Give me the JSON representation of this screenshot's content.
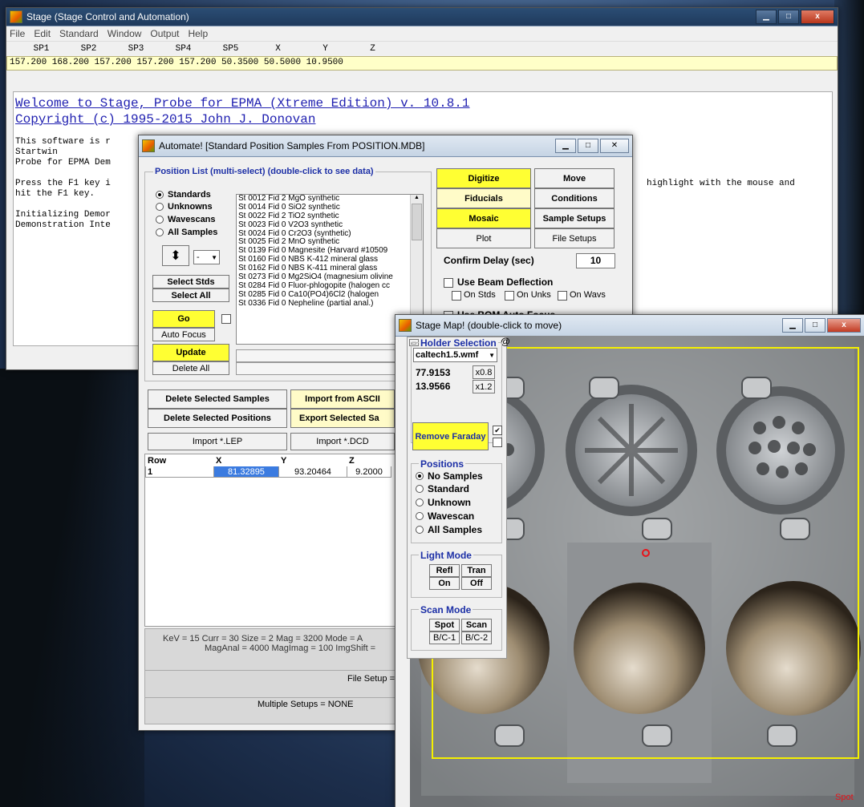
{
  "main_window": {
    "title": "Stage (Stage Control and Automation)",
    "menu": [
      "File",
      "Edit",
      "Standard",
      "Window",
      "Output",
      "Help"
    ],
    "position_headers": [
      "SP1",
      "SP2",
      "SP3",
      "SP4",
      "SP5",
      "X",
      "Y",
      "Z"
    ],
    "position_values": "157.200 168.200 157.200 157.200 157.200 50.3500 50.5000 10.9500",
    "log": {
      "welcome": "Welcome to Stage, Probe for EPMA (Xtreme Edition) v. 10.8.1",
      "copyright": "Copyright (c) 1995-2015 John J. Donovan",
      "line1": "This software is r",
      "line2": "Startwin",
      "line3": "Probe for EPMA Dem",
      "line4a": "Press the F1 key i",
      "line4b": "highlight with the mouse and",
      "line5": "hit the F1 key.",
      "line6": "Initializing Demor",
      "line7": "Demonstration Inte"
    }
  },
  "automate_window": {
    "title": "Automate! [Standard Position Samples From POSITION.MDB]",
    "position_list_title": "Position List (multi-select) (double-click to see data)",
    "sample_types": [
      "Standards",
      "Unknowns",
      "Wavescans",
      "All Samples"
    ],
    "selected_sample_type": "Standards",
    "list_items": [
      "St 0012 Fid 2  MgO synthetic",
      "St 0014 Fid 0  SiO2 synthetic",
      "St 0022 Fid 2  TiO2 synthetic",
      "St 0023 Fid 0  V2O3 synthetic",
      "St 0024 Fid 0  Cr2O3 (synthetic)",
      "St 0025 Fid 2  MnO synthetic",
      "St 0139 Fid 0  Magnesite (Harvard #10509",
      "St 0160 Fid 0  NBS K-412 mineral glass",
      "St 0162 Fid 0  NBS K-411 mineral glass",
      "St 0273 Fid 0  Mg2SiO4 (magnesium olivine",
      "St 0284 Fid 0  Fluor-phlogopite (halogen cc",
      "St 0285 Fid 0  Ca10(PO4)6Cl2 (halogen",
      "St 0336 Fid 0  Nepheline (partial anal.)"
    ],
    "dropdown_value": "-",
    "buttons": {
      "select_stds": "Select Stds",
      "select_all": "Select All",
      "go": "Go",
      "auto_focus": "Auto Focus",
      "update": "Update",
      "delete_all": "Delete All",
      "digitize": "Digitize",
      "move": "Move",
      "fiducials": "Fiducials",
      "conditions": "Conditions",
      "mosaic": "Mosaic",
      "sample_setups": "Sample Setups",
      "plot": "Plot",
      "file_setups": "File Setups",
      "delete_selected_samples": "Delete Selected Samples",
      "import_from_ascii": "Import from ASCII",
      "delete_selected_positions": "Delete Selected Positions",
      "export_selected": "Export Selected Sa",
      "import_lep": "Import *.LEP",
      "import_dcd": "Import *.DCD"
    },
    "confirm_delay_label": "Confirm Delay (sec)",
    "confirm_delay_value": "10",
    "use_beam_deflection": "Use Beam Deflection",
    "on_stds": "On Stds",
    "on_unks": "On Unks",
    "on_wavs": "On Wavs",
    "use_bom_auto_focus": "Use BOM Auto Focus",
    "table": {
      "headers": [
        "Row",
        "X",
        "Y",
        "Z"
      ],
      "rows": [
        [
          "1",
          "81.32895",
          "93.20464",
          "9.2000"
        ]
      ]
    },
    "conditions_line1": "KeV = 15   Curr = 30   Size = 2   Mag = 3200   Mode = A",
    "conditions_line2": "MagAnal = 4000   MagImag = 100   ImgShift =",
    "file_setup": "File Setup =",
    "multiple_setups": "Multiple Setups = NONE"
  },
  "map_window": {
    "title": "Stage Map! (double-click to move)",
    "holder_selection_title": "Holder Selection",
    "holder_value": "caltech1.5.wmf",
    "coord_x": "77.9153",
    "coord_y": "13.9566",
    "zoom_out": "x0.8",
    "zoom_in": "x1.2",
    "remove_faraday": "Remove Faraday",
    "positions_title": "Positions",
    "positions": [
      "No Samples",
      "Standard",
      "Unknown",
      "Wavescan",
      "All Samples"
    ],
    "selected_position": "No Samples",
    "light_mode_title": "Light Mode",
    "refl": "Refl",
    "tran": "Tran",
    "on": "On",
    "off": "Off",
    "scan_mode_title": "Scan Mode",
    "spot": "Spot",
    "scan": "Scan",
    "bc1": "B/C-1",
    "bc2": "B/C-2",
    "spot_label": "Spot"
  },
  "colors": {
    "yellow_button": "#ffff33",
    "position_bar": "#ffffc8",
    "group_title": "#1c2fa6",
    "welcome_text": "#1f1fb0",
    "map_frame": "#f5f000",
    "spot_marker": "#e8131a"
  }
}
